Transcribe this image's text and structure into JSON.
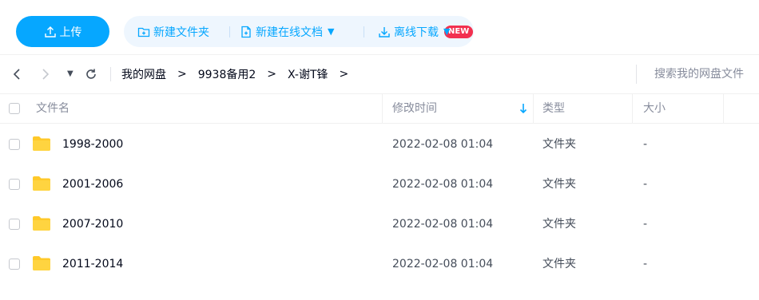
{
  "toolbar": {
    "upload_label": "上传",
    "new_folder_label": "新建文件夹",
    "new_online_doc_label": "新建在线文档",
    "new_badge": "NEW",
    "offline_download_label": "离线下载"
  },
  "nav": {
    "breadcrumbs": [
      "我的网盘",
      "9938备用2",
      "X-谢T锋"
    ],
    "search_placeholder": "搜索我的网盘文件"
  },
  "table": {
    "columns": {
      "name": "文件名",
      "modified": "修改时间",
      "type": "类型",
      "size": "大小"
    },
    "sort_column": "modified",
    "rows": [
      {
        "name": "1998-2000",
        "modified": "2022-02-08 01:04",
        "type": "文件夹",
        "size": "-"
      },
      {
        "name": "2001-2006",
        "modified": "2022-02-08 01:04",
        "type": "文件夹",
        "size": "-"
      },
      {
        "name": "2007-2010",
        "modified": "2022-02-08 01:04",
        "type": "文件夹",
        "size": "-"
      },
      {
        "name": "2011-2014",
        "modified": "2022-02-08 01:04",
        "type": "文件夹",
        "size": "-"
      }
    ]
  },
  "colors": {
    "accent": "#06a7ff",
    "badge": "#f2304f",
    "folder": "#ffc929"
  }
}
